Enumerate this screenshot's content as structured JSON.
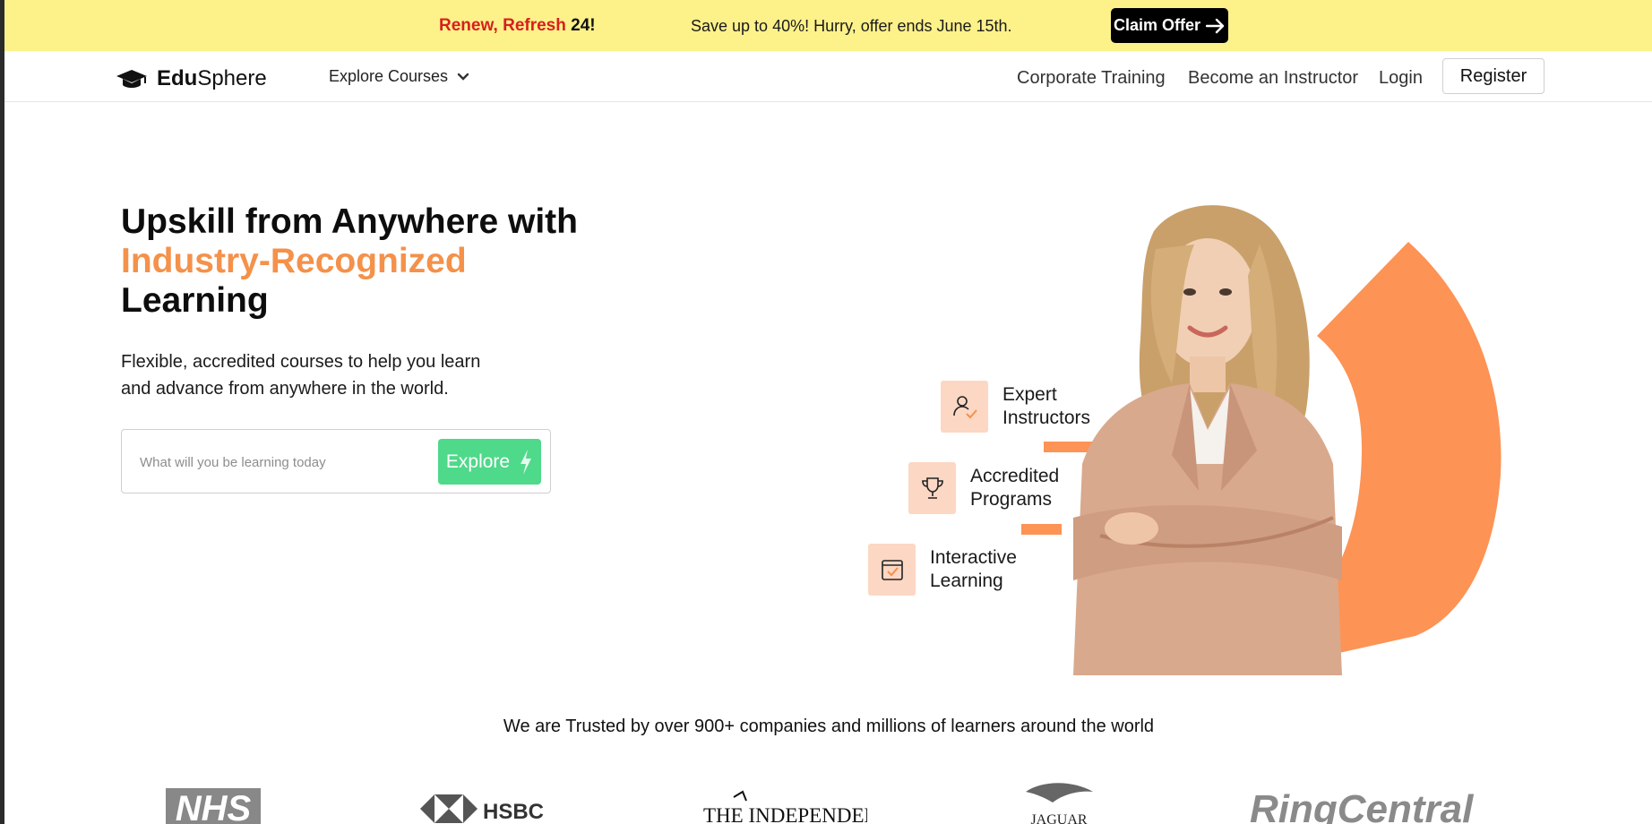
{
  "promo": {
    "renew_text": "Renew, Refresh",
    "renew_number": "24!",
    "message": "Save up to 40%! Hurry, offer ends June 15th.",
    "claim_label": "Claim Offer"
  },
  "nav": {
    "logo_bold": "Edu",
    "logo_regular": "Sphere",
    "explore_label": "Explore Courses",
    "links": [
      "Corporate Training",
      "Become an Instructor",
      "Login"
    ],
    "register_label": "Register"
  },
  "hero": {
    "title_line1": "Upskill from Anywhere with",
    "title_accent": "Industry-Recognized",
    "title_line3": "Learning",
    "subtitle_line1": "Flexible, accredited courses to help you learn",
    "subtitle_line2": "and advance from anywhere in the world.",
    "search_placeholder": "What will you be learning today",
    "search_value": "",
    "explore_button": "Explore"
  },
  "features": [
    {
      "line1": "Expert",
      "line2": "Instructors",
      "icon": "expert-instructor-icon"
    },
    {
      "line1": "Accredited",
      "line2": "Programs",
      "icon": "trophy-icon"
    },
    {
      "line1": "Interactive",
      "line2": "Learning",
      "icon": "calendar-check-icon"
    }
  ],
  "trusted": {
    "text": "We are Trusted by over 900+ companies and millions of learners around the world",
    "brands": [
      "NHS",
      "HSBC",
      "THE INDEPENDENT",
      "JAGUAR",
      "RingCentral"
    ]
  },
  "colors": {
    "promo_bg": "#fdf18a",
    "accent_orange": "#f4914a",
    "explore_green": "#4fd98a",
    "feature_icon_bg": "#fcd7c4"
  }
}
